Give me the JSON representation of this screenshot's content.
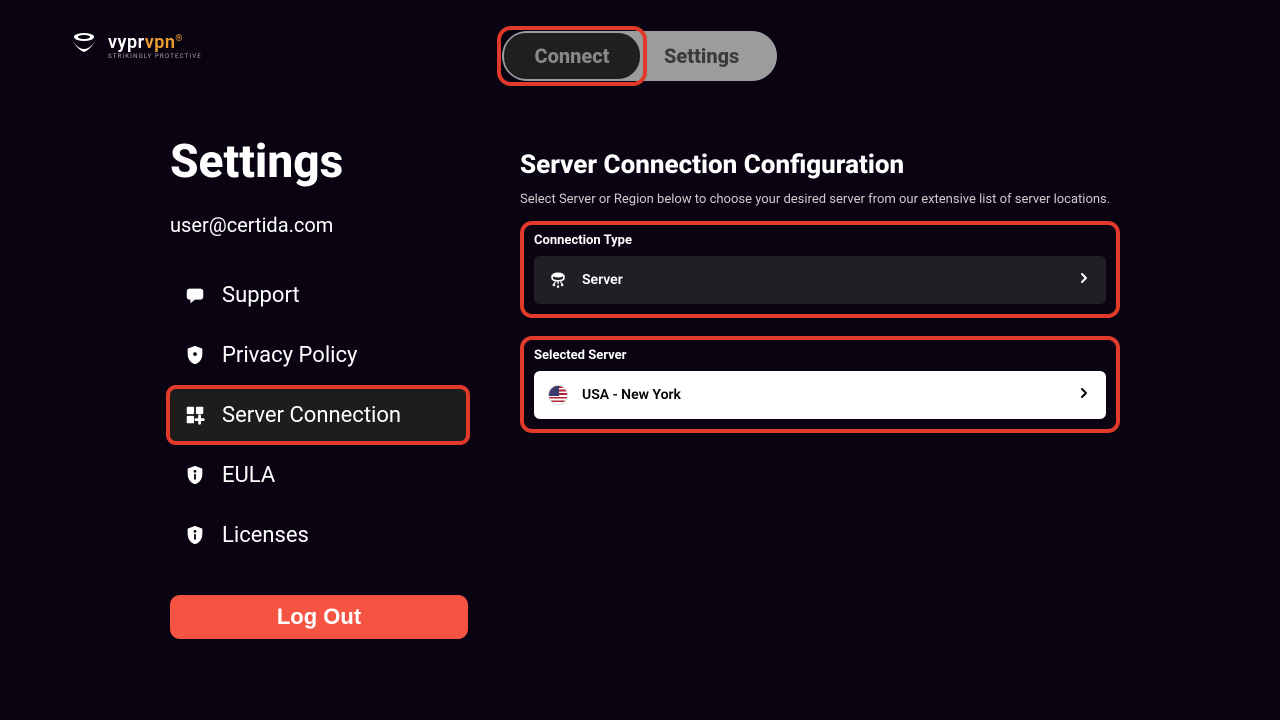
{
  "logo": {
    "brand_part1": "vypr",
    "brand_part2": "vpn",
    "reg": "®",
    "tagline": "STRIKINGLY PROTECTIVE"
  },
  "nav": {
    "connect": "Connect",
    "settings": "Settings"
  },
  "sidebar": {
    "title": "Settings",
    "email": "user@certida.com",
    "items": [
      {
        "label": "Support"
      },
      {
        "label": "Privacy Policy"
      },
      {
        "label": "Server Connection"
      },
      {
        "label": "EULA"
      },
      {
        "label": "Licenses"
      }
    ],
    "logout": "Log Out"
  },
  "main": {
    "title": "Server Connection Configuration",
    "description": "Select Server or Region below to choose your desired server from our extensive list of server locations.",
    "connection_type_label": "Connection Type",
    "connection_type_value": "Server",
    "selected_server_label": "Selected Server",
    "selected_server_value": "USA - New York"
  }
}
